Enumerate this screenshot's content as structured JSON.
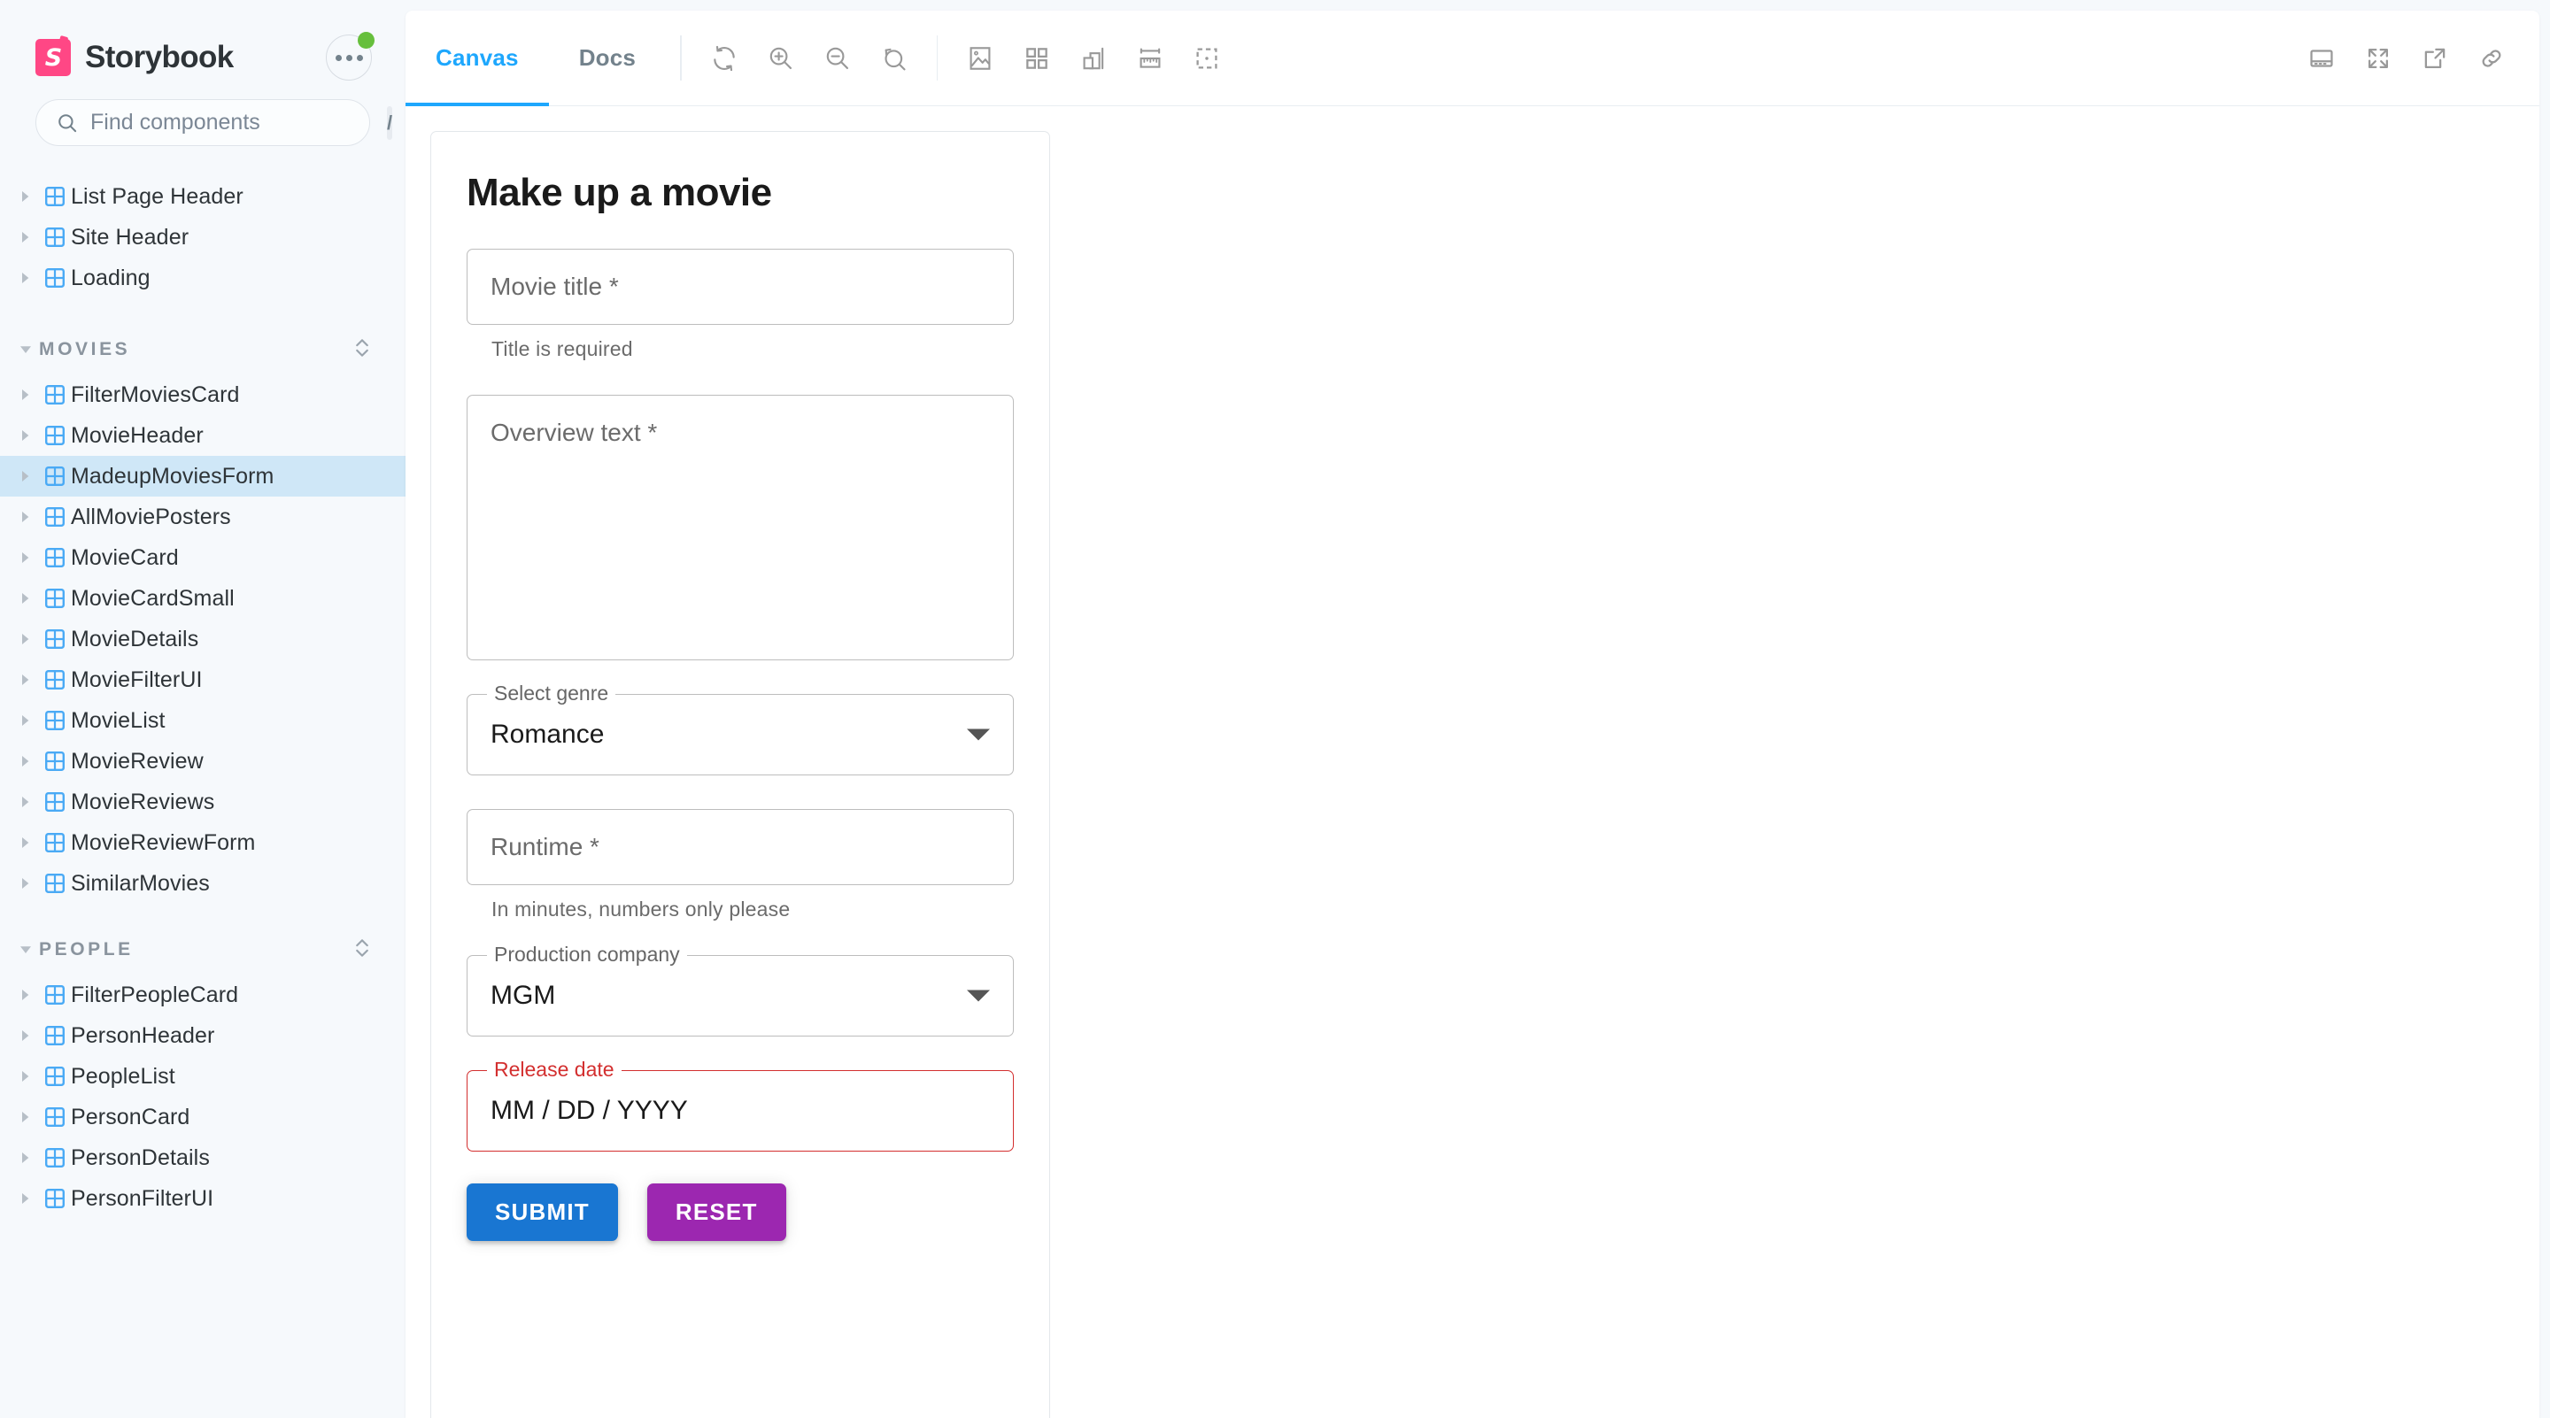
{
  "app": {
    "brand_name": "Storybook",
    "brand_initial": "S",
    "menu_button": "more-options"
  },
  "search": {
    "placeholder": "Find components",
    "value": "",
    "shortcut_key": "/"
  },
  "sidebar": {
    "root_items": [
      {
        "label": "List Page Header"
      },
      {
        "label": "Site Header"
      },
      {
        "label": "Loading"
      }
    ],
    "groups": [
      {
        "title": "MOVIES",
        "items": [
          {
            "label": "FilterMoviesCard",
            "selected": false
          },
          {
            "label": "MovieHeader",
            "selected": false
          },
          {
            "label": "MadeupMoviesForm",
            "selected": true
          },
          {
            "label": "AllMoviePosters",
            "selected": false
          },
          {
            "label": "MovieCard",
            "selected": false
          },
          {
            "label": "MovieCardSmall",
            "selected": false
          },
          {
            "label": "MovieDetails",
            "selected": false
          },
          {
            "label": "MovieFilterUI",
            "selected": false
          },
          {
            "label": "MovieList",
            "selected": false
          },
          {
            "label": "MovieReview",
            "selected": false
          },
          {
            "label": "MovieReviews",
            "selected": false
          },
          {
            "label": "MovieReviewForm",
            "selected": false
          },
          {
            "label": "SimilarMovies",
            "selected": false
          }
        ]
      },
      {
        "title": "PEOPLE",
        "items": [
          {
            "label": "FilterPeopleCard",
            "selected": false
          },
          {
            "label": "PersonHeader",
            "selected": false
          },
          {
            "label": "PeopleList",
            "selected": false
          },
          {
            "label": "PersonCard",
            "selected": false
          },
          {
            "label": "PersonDetails",
            "selected": false
          },
          {
            "label": "PersonFilterUI",
            "selected": false
          }
        ]
      }
    ]
  },
  "toolbar": {
    "tabs": [
      {
        "label": "Canvas",
        "active": true
      },
      {
        "label": "Docs",
        "active": false
      }
    ],
    "left_tools": [
      "remount-icon",
      "zoom-in-icon",
      "zoom-out-icon",
      "zoom-reset-icon"
    ],
    "addon_tools": [
      "backgrounds-icon",
      "grid-icon",
      "viewport-icon",
      "measure-icon",
      "outline-icon"
    ],
    "right_tools": [
      "addons-panel-icon",
      "fullscreen-icon",
      "open-in-new-tab-icon",
      "copy-link-icon"
    ]
  },
  "story": {
    "title": "Make up a movie",
    "fields": {
      "movie_title": {
        "placeholder": "Movie title *",
        "value": "",
        "helper": "Title is required"
      },
      "overview": {
        "placeholder": "Overview text *",
        "value": ""
      },
      "genre": {
        "label": "Select genre",
        "value": "Romance"
      },
      "runtime": {
        "placeholder": "Runtime *",
        "value": "",
        "helper": "In minutes, numbers only please"
      },
      "production_company": {
        "label": "Production company",
        "value": "MGM"
      },
      "release_date": {
        "label": "Release date",
        "value": "MM / DD / YYYY",
        "error": true
      }
    },
    "buttons": {
      "submit": "SUBMIT",
      "reset": "RESET"
    }
  },
  "colors": {
    "brand_pink": "#ff4785",
    "accent_blue": "#1ea7fd",
    "submit_blue": "#1976d2",
    "reset_purple": "#9c27b0",
    "error_red": "#d32f2f",
    "selected_row": "#cfe7f7",
    "status_green": "#66bf3c"
  }
}
